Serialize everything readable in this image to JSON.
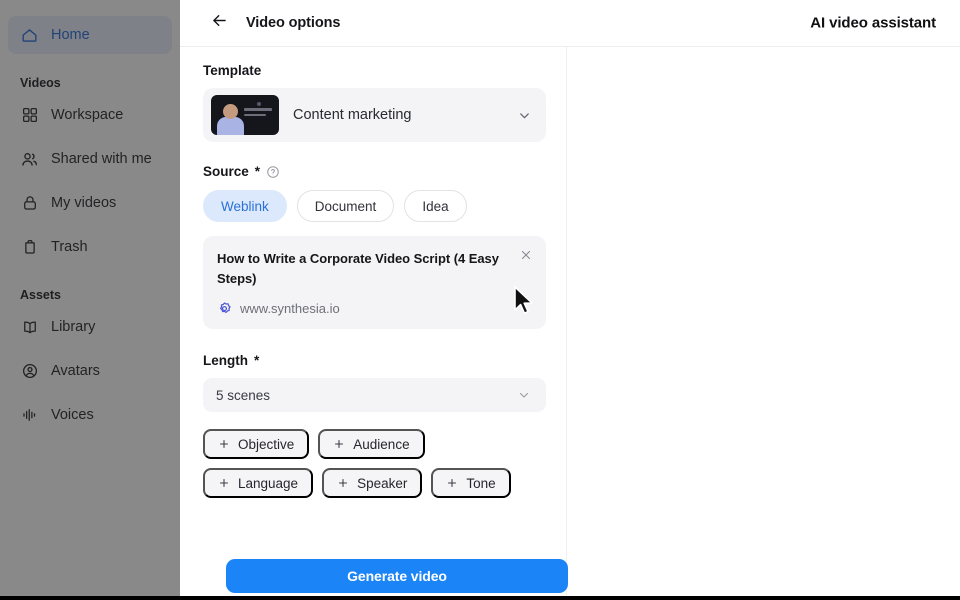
{
  "sidebar": {
    "home": {
      "label": "Home",
      "icon": "home-icon"
    },
    "sections": [
      {
        "title": "Videos",
        "items": [
          {
            "label": "Workspace",
            "icon": "grid-icon"
          },
          {
            "label": "Shared with me",
            "icon": "people-icon"
          },
          {
            "label": "My videos",
            "icon": "lock-icon"
          },
          {
            "label": "Trash",
            "icon": "trash-icon"
          }
        ]
      },
      {
        "title": "Assets",
        "items": [
          {
            "label": "Library",
            "icon": "book-icon"
          },
          {
            "label": "Avatars",
            "icon": "user-circle-icon"
          },
          {
            "label": "Voices",
            "icon": "waveform-icon"
          }
        ]
      }
    ]
  },
  "header": {
    "back_icon": "arrow-left-icon",
    "title": "Video options",
    "assistant_title": "AI video assistant"
  },
  "form": {
    "template": {
      "label": "Template",
      "value": "Content marketing",
      "chevron_icon": "chevron-down-icon",
      "thumbnail_alt": "presenter on dark background"
    },
    "source": {
      "label": "Source",
      "required_mark": "*",
      "help_icon": "question-circle-icon",
      "options": [
        "Weblink",
        "Document",
        "Idea"
      ],
      "selected": "Weblink"
    },
    "weblink": {
      "title": "How to Write a Corporate Video Script (4 Easy Steps)",
      "url": "www.synthesia.io",
      "favicon": "synthesia-logo-icon",
      "close_icon": "close-icon"
    },
    "length": {
      "label": "Length",
      "required_mark": "*",
      "value": "5 scenes",
      "chevron_icon": "chevron-down-icon"
    },
    "chips": [
      {
        "label": "Objective",
        "icon": "plus-icon"
      },
      {
        "label": "Audience",
        "icon": "plus-icon"
      },
      {
        "label": "Language",
        "icon": "plus-icon"
      },
      {
        "label": "Speaker",
        "icon": "plus-icon"
      },
      {
        "label": "Tone",
        "icon": "plus-icon"
      }
    ],
    "generate_button": "Generate video"
  },
  "colors": {
    "accent_blue": "#1b84f7",
    "selected_chip_bg": "#dce8fb",
    "selected_chip_text": "#2a72d8",
    "panel_bg": "#ffffff",
    "field_bg": "#f4f4f6"
  }
}
